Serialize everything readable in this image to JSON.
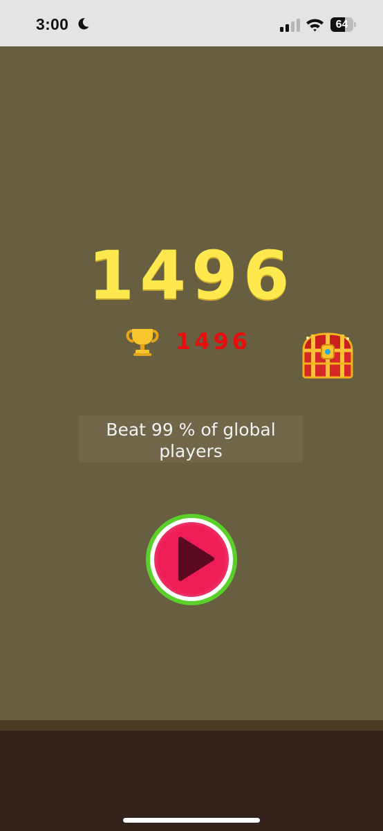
{
  "status_bar": {
    "time": "3:00",
    "moon_icon": "moon-icon",
    "signal_icon": "signal-bars-icon",
    "wifi_icon": "wifi-icon",
    "battery_percent": "64",
    "battery_level": 0.64
  },
  "game": {
    "score": "1496",
    "best_score": "1496",
    "trophy_icon": "trophy-icon",
    "chest_icon": "treasure-chest-icon",
    "beat_text": "Beat 99 % of global players",
    "play_icon": "play-icon"
  },
  "colors": {
    "background": "#685e40",
    "score": "#fde84d",
    "best_score": "#ea0d0d",
    "play_button_ring": "#5ad12b",
    "play_button_fill": "#ee1d57",
    "ground": "#33231a"
  }
}
